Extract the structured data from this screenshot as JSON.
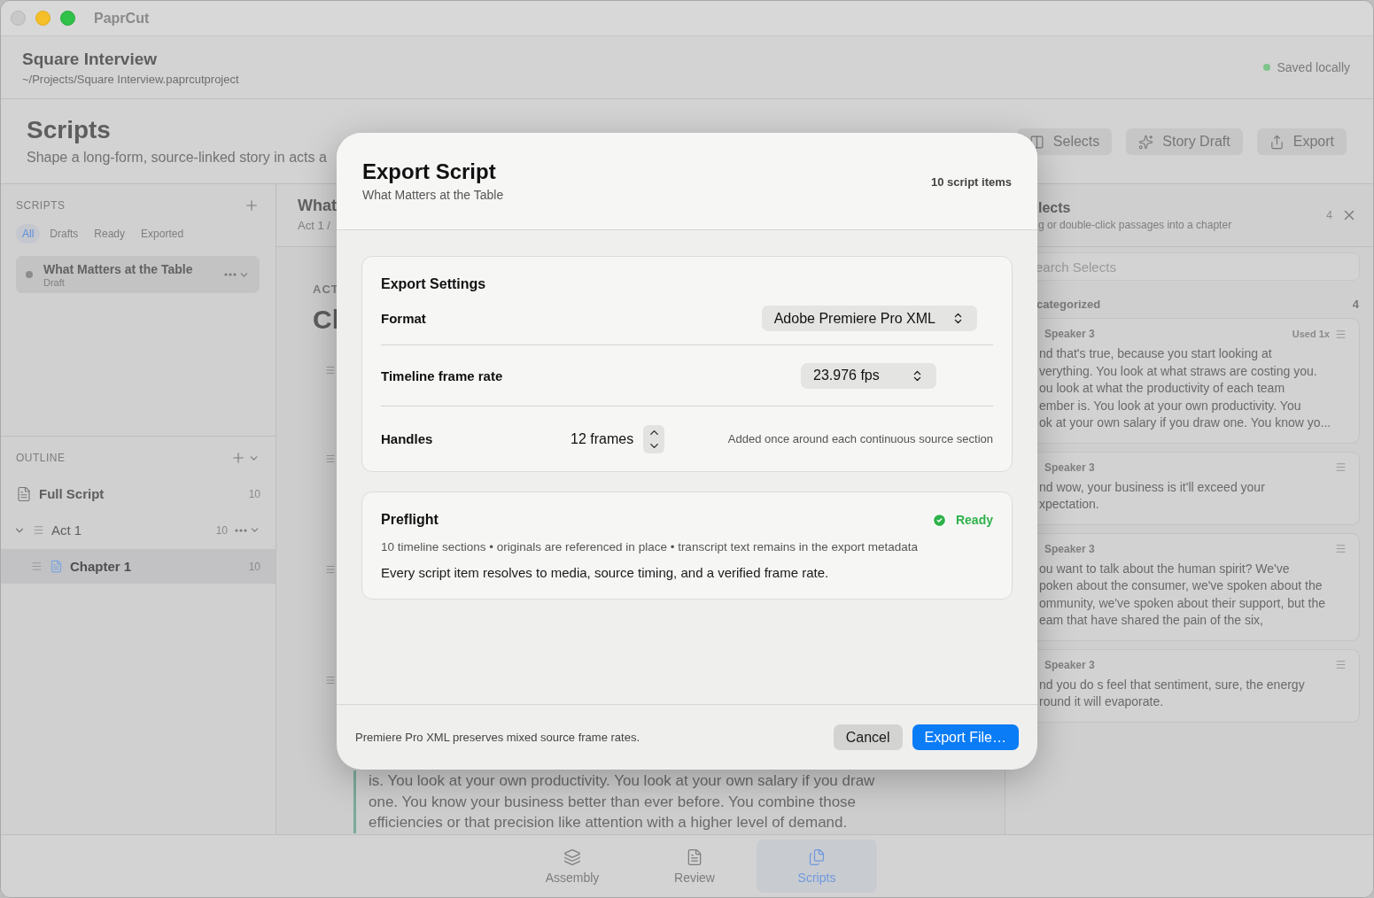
{
  "app": {
    "title": "PaprCut"
  },
  "project": {
    "title": "Square Interview",
    "path": "~/Projects/Square Interview.paprcutproject",
    "status": "Saved locally"
  },
  "page": {
    "title": "Scripts",
    "subtitle": "Shape a long-form, source-linked story in acts a"
  },
  "toolbar": [
    {
      "label": "Selects",
      "kind": "selects"
    },
    {
      "label": "Story Draft",
      "kind": "draft"
    },
    {
      "label": "Export",
      "kind": "export"
    }
  ],
  "scripts_panel": {
    "heading": "SCRIPTS",
    "filters": [
      {
        "label": "All",
        "selected": true
      },
      {
        "label": "Drafts",
        "selected": false
      },
      {
        "label": "Ready",
        "selected": false
      },
      {
        "label": "Exported",
        "selected": false
      }
    ],
    "items": [
      {
        "title": "What Matters at the Table",
        "status": "Draft",
        "selected": true
      }
    ]
  },
  "outline": {
    "heading": "OUTLINE",
    "items": [
      {
        "label": "Full Script",
        "count": "10",
        "kind": "script",
        "selected": false
      },
      {
        "label": "Act 1",
        "count": "10",
        "kind": "act",
        "selected": false,
        "expanded": true,
        "children": [
          {
            "label": "Chapter 1",
            "count": "10",
            "kind": "chapter",
            "selected": true
          }
        ]
      }
    ]
  },
  "editor": {
    "title": "What",
    "breadcrumb": "Act 1 /",
    "act_label": "ACT",
    "chapter_title": "Cl",
    "passage": "is. You look at your own productivity. You look at your own salary if you draw\none. You know your business better than ever before. You combine those\nefficiencies or that precision like attention with a higher level of demand."
  },
  "selects_panel": {
    "title": "lects",
    "subtitle": "g or double-click passages into a chapter",
    "count": "4",
    "search_placeholder": "earch Selects",
    "group": {
      "label": "categorized",
      "count": "4"
    },
    "cards": [
      {
        "speaker": "Speaker 3",
        "used": "Used 1x",
        "text": "nd that's true, because you start looking at\nverything. You look at what straws are costing you.\nou look at what the productivity of each team\nember is. You look at your own productivity. You\nok at your own salary if you draw one. You know yo..."
      },
      {
        "speaker": "Speaker 3",
        "text": "nd wow, your business is it'll exceed your\nxpectation."
      },
      {
        "speaker": "Speaker 3",
        "text": "ou want to talk about the human spirit? We've\npoken about the consumer, we've spoken about the\nommunity, we've spoken about their support, but the\neam that have shared the pain of the six,"
      },
      {
        "speaker": "Speaker 3",
        "text": "nd you do s feel that sentiment, sure, the energy\nround it will evaporate."
      }
    ]
  },
  "dialog": {
    "title": "Export Script",
    "subtitle": "What Matters at the Table",
    "count": "10 script items",
    "settings": {
      "heading": "Export Settings",
      "format": {
        "label": "Format",
        "value": "Adobe Premiere Pro XML"
      },
      "frame_rate": {
        "label": "Timeline frame rate",
        "value": "23.976 fps"
      },
      "handles": {
        "label": "Handles",
        "value": "12 frames",
        "note": "Added once around each continuous source section"
      }
    },
    "preflight": {
      "heading": "Preflight",
      "status": "Ready",
      "ready": true,
      "details": "10 timeline sections • originals are referenced in place • transcript text remains in the export metadata",
      "message": "Every script item resolves to media, source timing, and a verified frame rate."
    },
    "footer_note": "Premiere Pro XML preserves mixed source frame rates.",
    "buttons": [
      {
        "label": "Cancel",
        "kind": "secondary"
      },
      {
        "label": "Export File…",
        "kind": "primary"
      }
    ]
  },
  "tabbar": [
    {
      "label": "Assembly",
      "kind": "assembly",
      "selected": false
    },
    {
      "label": "Review",
      "kind": "review",
      "selected": false
    },
    {
      "label": "Scripts",
      "kind": "scripts",
      "selected": true
    }
  ]
}
